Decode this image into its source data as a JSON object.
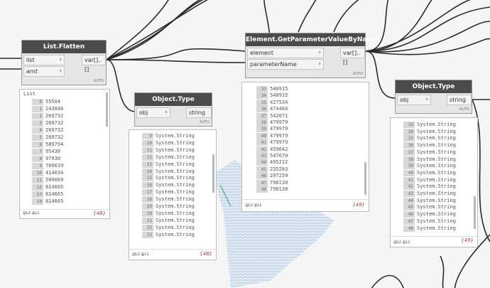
{
  "nodes": {
    "flatten": {
      "title": "List.Flatten",
      "inputs": [
        "list",
        "amt"
      ],
      "output": "var[]..[]",
      "lacing": "AUTO",
      "preview": {
        "header": "List",
        "rows": [
          [
            "0",
            "55504"
          ],
          [
            "1",
            "243846"
          ],
          [
            "2",
            "269732"
          ],
          [
            "3",
            "269732"
          ],
          [
            "4",
            "269732"
          ],
          [
            "5",
            "269732"
          ],
          [
            "6",
            "589794"
          ],
          [
            "7",
            "95430"
          ],
          [
            "8",
            "97930"
          ],
          [
            "9",
            "709039"
          ],
          [
            "10",
            "414034"
          ],
          [
            "11",
            "509069"
          ],
          [
            "12",
            "814665"
          ],
          [
            "13",
            "814665"
          ],
          [
            "14",
            "814665"
          ]
        ],
        "levels": "@L2 @L1",
        "count": "{48}"
      }
    },
    "type1": {
      "title": "Object.Type",
      "input": "obj",
      "output": "string",
      "lacing": "AUTO",
      "preview": {
        "rows": [
          [
            "9",
            "System.String"
          ],
          [
            "10",
            "System.String"
          ],
          [
            "11",
            "System.String"
          ],
          [
            "12",
            "System.String"
          ],
          [
            "13",
            "System.String"
          ],
          [
            "14",
            "System.String"
          ],
          [
            "15",
            "System.String"
          ],
          [
            "16",
            "System.String"
          ],
          [
            "17",
            "System.String"
          ],
          [
            "18",
            "System.String"
          ],
          [
            "19",
            "System.String"
          ],
          [
            "20",
            "System.String"
          ],
          [
            "21",
            "System.String"
          ],
          [
            "22",
            "System.String"
          ],
          [
            "23",
            "System.String"
          ]
        ],
        "levels": "@L2 @L1",
        "count": "{48}"
      }
    },
    "getparam": {
      "title": "Element.GetParameterValueByName",
      "inputs": [
        "element",
        "parameterName"
      ],
      "output": "var[]..[]",
      "lacing": "AUTO",
      "preview": {
        "rows": [
          [
            "33",
            "540915"
          ],
          [
            "34",
            "540915"
          ],
          [
            "35",
            "427534"
          ],
          [
            "36",
            "474460"
          ],
          [
            "37",
            "542071"
          ],
          [
            "38",
            "479979"
          ],
          [
            "39",
            "479979"
          ],
          [
            "40",
            "479979"
          ],
          [
            "41",
            "479979"
          ],
          [
            "42",
            "459642"
          ],
          [
            "43",
            "547670"
          ],
          [
            "44",
            "495212"
          ],
          [
            "45",
            "235283"
          ],
          [
            "46",
            "297259"
          ],
          [
            "47",
            "790130"
          ],
          [
            "48",
            "790130"
          ]
        ],
        "levels": "@L2 @L1",
        "count": "{49}"
      }
    },
    "type2": {
      "title": "Object.Type",
      "input": "obj",
      "output": "string",
      "lacing": "AUTO",
      "preview": {
        "rows": [
          [
            "33",
            "System.String"
          ],
          [
            "34",
            "System.String"
          ],
          [
            "35",
            "System.String"
          ],
          [
            "36",
            "System.String"
          ],
          [
            "37",
            "System.String"
          ],
          [
            "38",
            "System.String"
          ],
          [
            "39",
            "System.String"
          ],
          [
            "40",
            "System.String"
          ],
          [
            "41",
            "System.String"
          ],
          [
            "42",
            "System.String"
          ],
          [
            "43",
            "System.String"
          ],
          [
            "44",
            "System.String"
          ],
          [
            "45",
            "System.String"
          ],
          [
            "46",
            "System.String"
          ],
          [
            "47",
            "System.String"
          ],
          [
            "48",
            "System.String"
          ]
        ],
        "levels": "@L2 @L1",
        "count": "{49}"
      }
    }
  }
}
